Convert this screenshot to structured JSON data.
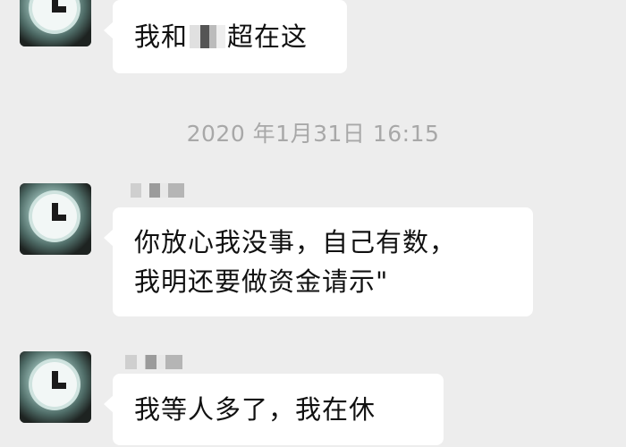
{
  "messages": [
    {
      "lines": [
        "我和",
        "超在这"
      ]
    },
    {
      "lines": [
        "你放心我没事，自己有数，",
        "我明还要做资金请示\""
      ]
    },
    {
      "lines": [
        "我等人多了，我在休"
      ]
    }
  ],
  "timestamp": "2020 年1月31日 16:15",
  "colors": {
    "background": "#ededed",
    "bubble": "#ffffff",
    "timestamp": "#a8a8a8"
  },
  "icons": {
    "avatar": "clock-avatar-icon"
  }
}
